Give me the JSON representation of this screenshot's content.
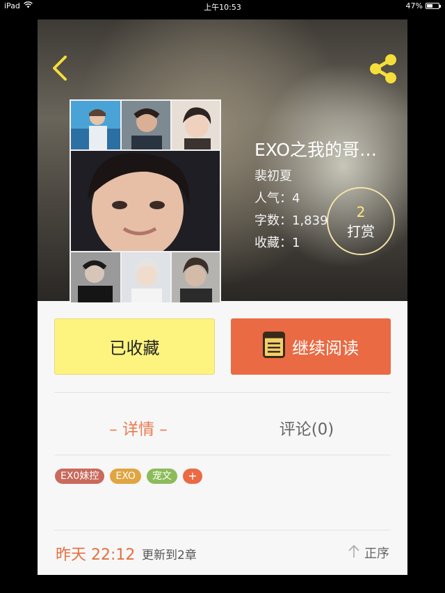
{
  "status_bar": {
    "device": "iPad",
    "time": "上午10:53",
    "battery": "47%",
    "battery_level": 0.47
  },
  "header": {
    "back_icon": "chevron-left-icon",
    "share_icon": "share-icon",
    "accent_color": "#f5de3a"
  },
  "book": {
    "title": "EXO之我的哥…",
    "author": "裴初夏",
    "popularity": "人气：4",
    "word_count": "字数：1,839",
    "favorites": "收藏：1"
  },
  "tip": {
    "count": "2",
    "label": "打赏"
  },
  "actions": {
    "favorited_label": "已收藏",
    "continue_label": "继续阅读",
    "continue_icon": "book-icon",
    "fav_color": "#fdf480",
    "read_color": "#ea6a43"
  },
  "tabs": {
    "detail": "– 详情 –",
    "comments": "评论(0)"
  },
  "tags": [
    {
      "label": "EX0妹控",
      "color": "#c86a5c"
    },
    {
      "label": "EXO",
      "color": "#e0a440"
    },
    {
      "label": "宠文",
      "color": "#8dbb5a"
    },
    {
      "label": "+",
      "color": "#ea6a43"
    }
  ],
  "update": {
    "time": "昨天 22:12",
    "text": "更新到2章",
    "order_label": "正序",
    "order_icon": "arrow-up-icon"
  }
}
